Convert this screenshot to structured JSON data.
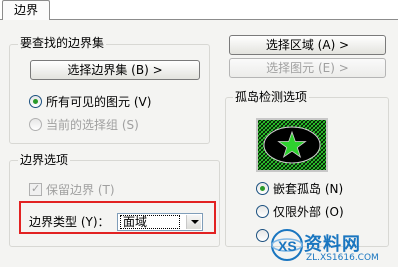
{
  "tab": {
    "label": "边界"
  },
  "search_group": {
    "title": "要查找的边界集",
    "select_button": "选择边界集 (B) >",
    "radio_all": "所有可见的图元 (V)",
    "radio_current": "当前的选择组 (S)"
  },
  "right_buttons": {
    "select_region": "选择区域 (A) >",
    "select_entity": "选择图元 (E) >"
  },
  "island_group": {
    "title": "孤岛检测选项",
    "radio_nested": "嵌套孤岛 (N)",
    "radio_outer": "仅限外部 (O)"
  },
  "boundary_options": {
    "title": "边界选项",
    "keep_boundary": "保留边界 (T)",
    "type_label": "边界类型 (Y)：",
    "type_value": "面域"
  },
  "watermark": {
    "text": "资料网",
    "url": "ZL.XS1616.COM",
    "logo_letters": "XS"
  },
  "colors": {
    "highlight": "#e22222",
    "preview_green": "#2fd12f",
    "watermark_blue": "#1a76c0"
  }
}
